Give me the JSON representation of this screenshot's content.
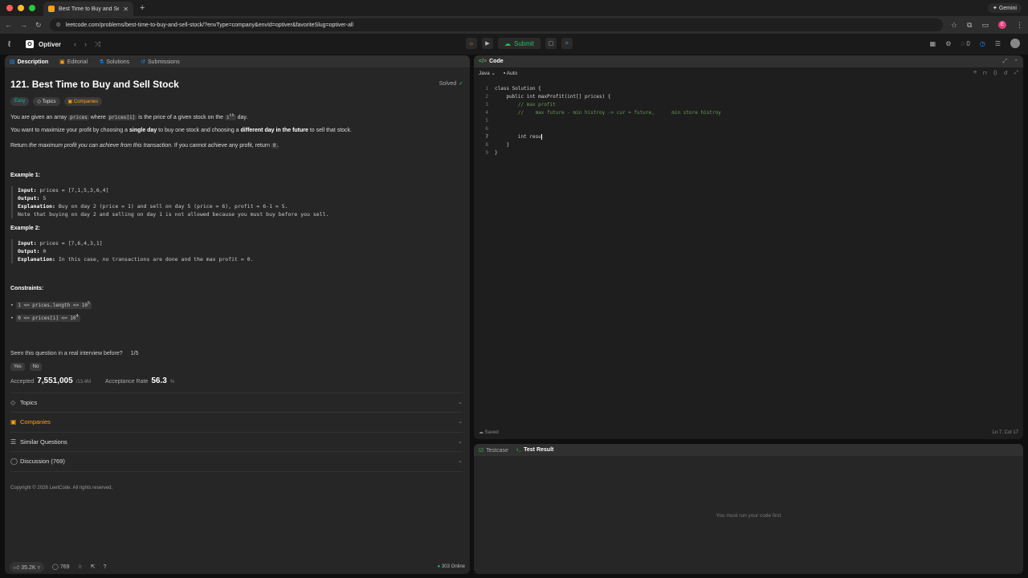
{
  "browser": {
    "tab_title": "Best Time to Buy and Sell St...",
    "url": "leetcode.com/problems/best-time-to-buy-and-sell-stock/?envType=company&envId=optiver&favoriteSlug=optiver-all",
    "gemini_label": "Gemini",
    "profile_initial": "E"
  },
  "nav": {
    "list_name": "Optiver",
    "list_badge": "O",
    "submit_label": "Submit",
    "streak": "0"
  },
  "left": {
    "tabs": [
      "Description",
      "Editorial",
      "Solutions",
      "Submissions"
    ],
    "title": "121. Best Time to Buy and Sell Stock",
    "solved": "Solved",
    "tags": {
      "difficulty": "Easy",
      "topics": "Topics",
      "companies": "Companies"
    },
    "para1": {
      "a": "You are given an array ",
      "code1": "prices",
      "b": " where ",
      "code2": "prices[i]",
      "c": " is the price of a given stock on the ",
      "sup": "i",
      "th": "th",
      "d": " day."
    },
    "para2": {
      "a": "You want to maximize your profit by choosing a ",
      "b1": "single day",
      "c": " to buy one stock and choosing a ",
      "b2": "different day in the future",
      "d": " to sell that stock."
    },
    "para3": {
      "a": "Return ",
      "i": "the maximum profit you can achieve from this transaction",
      "b": ". If you cannot achieve any profit, return ",
      "code": "0",
      "c": "."
    },
    "example1": {
      "heading": "Example 1:",
      "input_label": "Input:",
      "input": " prices = [7,1,5,3,6,4]",
      "output_label": "Output:",
      "output": " 5",
      "expl_label": "Explanation:",
      "expl": " Buy on day 2 (price = 1) and sell on day 5 (price = 6), profit = 6-1 = 5.",
      "note": "Note that buying on day 2 and selling on day 1 is not allowed because you must buy before you sell."
    },
    "example2": {
      "heading": "Example 2:",
      "input_label": "Input:",
      "input": " prices = [7,6,4,3,1]",
      "output_label": "Output:",
      "output": " 0",
      "expl_label": "Explanation:",
      "expl": " In this case, no transactions are done and the max profit = 0."
    },
    "constraints": {
      "heading": "Constraints:",
      "c1": "1 <= prices.length <= 10",
      "c1_sup": "5",
      "c2": "0 <= prices[i] <= 10",
      "c2_sup": "4"
    },
    "seen": {
      "question": "Seen this question in a real interview before?",
      "count": "1/5",
      "yes": "Yes",
      "no": "No"
    },
    "stats": {
      "accepted_label": "Accepted",
      "accepted": "7,551,005",
      "submissions": "/13.4M",
      "rate_label": "Acceptance Rate",
      "rate": "56.3",
      "rate_unit": "%"
    },
    "accordions": [
      "Topics",
      "Companies",
      "Similar Questions",
      "Discussion (769)"
    ],
    "copyright": "Copyright © 2026 LeetCode. All rights reserved.",
    "bottom": {
      "likes": "35.2K",
      "comments": "769",
      "online": "303 Online"
    }
  },
  "code": {
    "tab": "Code",
    "language": "Java",
    "mode": "Auto",
    "lines": [
      "class Solution {",
      "    public int maxProfit(int[] prices) {",
      "        // max profit",
      "        //    max future - min histroy -> cur = future,      min store histroy",
      "",
      "",
      "        int resu",
      "    }",
      "}"
    ],
    "saved": "Saved",
    "cursor": "Ln 7, Col 17"
  },
  "test": {
    "tabs": [
      "Testcase",
      "Test Result"
    ],
    "message": "You must run your code first"
  }
}
